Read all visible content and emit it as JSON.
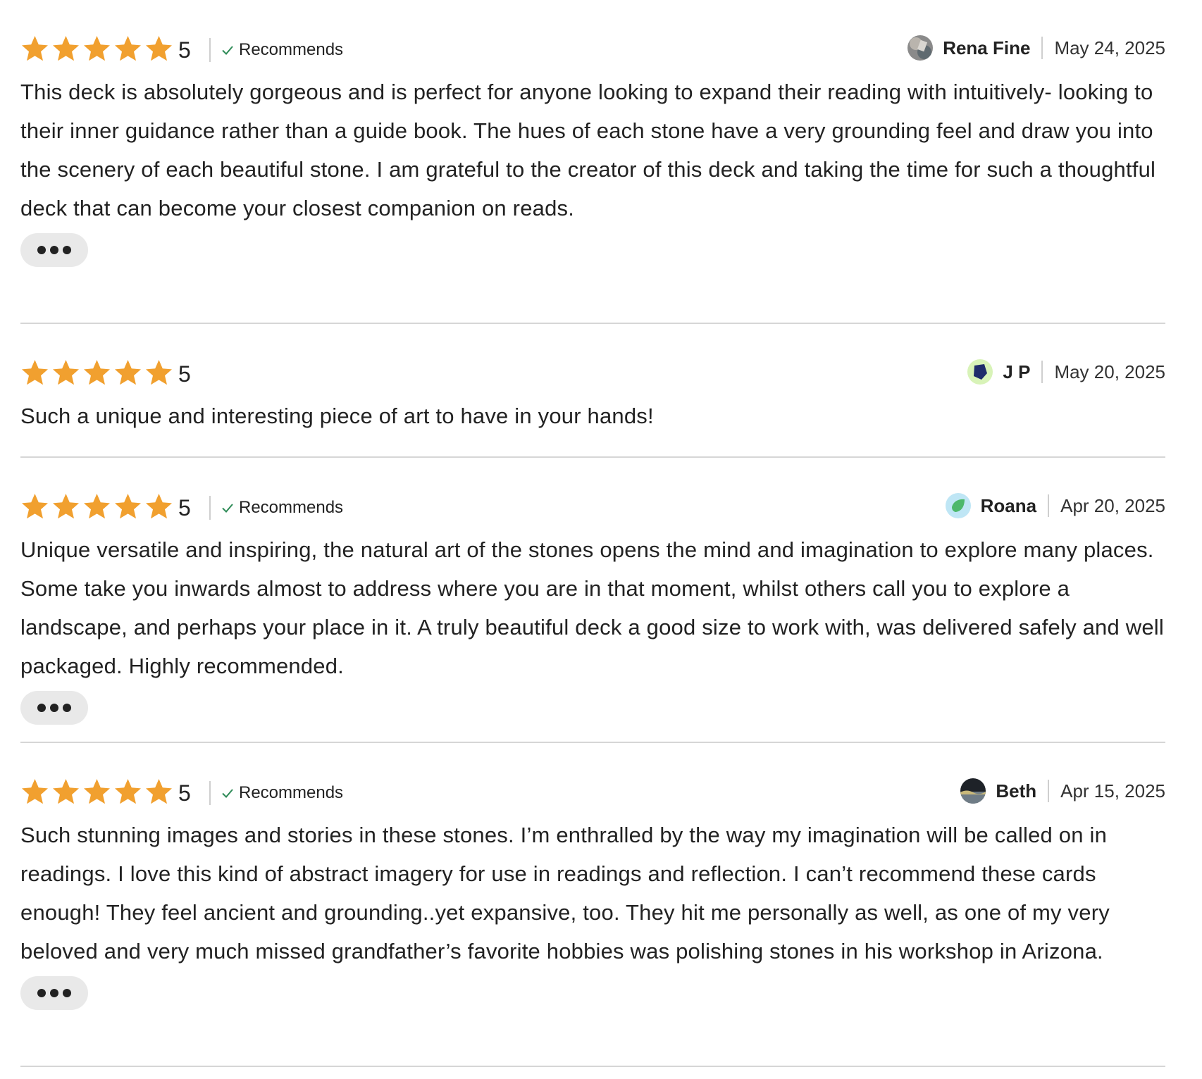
{
  "reviews": [
    {
      "rating": "5",
      "stars": 5,
      "recommends": true,
      "recommends_label": "Recommends",
      "author": "Rena Fine",
      "date": "May 24, 2025",
      "avatar_icon": "photo-avatar-icon",
      "text": "This deck is absolutely gorgeous and is perfect for anyone looking to expand their reading with intuitively- looking to their inner guidance rather than a guide book. The hues of each stone have a very grounding feel and draw you into the scenery of each beautiful stone. I am grateful to the creator of this deck and taking the time for such a thoughtful deck that can become your closest companion on reads.",
      "has_more": true
    },
    {
      "rating": "5",
      "stars": 5,
      "recommends": false,
      "author": "J P",
      "date": "May 20, 2025",
      "avatar_icon": "navy-pentagon-avatar-icon",
      "text": "Such a unique and interesting piece of art to have in your hands!",
      "has_more": false
    },
    {
      "rating": "5",
      "stars": 5,
      "recommends": true,
      "recommends_label": "Recommends",
      "author": "Roana",
      "date": "Apr 20, 2025",
      "avatar_icon": "green-leaf-avatar-icon",
      "text": "Unique versatile and inspiring, the natural art of the stones opens the mind and imagination to explore many places. Some take you inwards almost to address where you are in that moment, whilst others call you to explore a landscape, and perhaps your place in it. A truly beautiful deck a good size to work with, was delivered safely and well packaged. Highly recommended.",
      "has_more": true
    },
    {
      "rating": "5",
      "stars": 5,
      "recommends": true,
      "recommends_label": "Recommends",
      "author": "Beth",
      "date": "Apr 15, 2025",
      "avatar_icon": "photo-avatar-icon",
      "text": "Such stunning images and stories in these stones. I’m enthralled by the way my imagination will be called on in readings. I love this kind of abstract imagery for use in readings and reflection. I can’t recommend these cards enough! They feel ancient and grounding..yet expansive, too. They hit me personally as well, as one of my very beloved and very much missed grandfather’s favorite hobbies was polishing stones in his workshop in Arizona.",
      "has_more": true
    }
  ],
  "colors": {
    "star": "#F1A02F",
    "check": "#2E8B57",
    "divider": "#D6D6D6",
    "more_button_bg": "#E9E9E9"
  }
}
